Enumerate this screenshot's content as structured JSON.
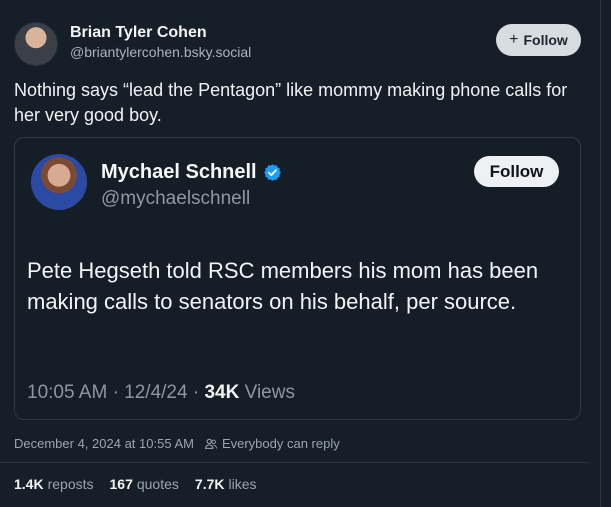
{
  "author": {
    "name": "Brian Tyler Cohen",
    "handle": "@briantylercohen.bsky.social",
    "follow_label": "Follow",
    "follow_icon": "+"
  },
  "post": {
    "text": "Nothing says “lead the Pentagon” like mommy making phone calls for her very good boy."
  },
  "embed": {
    "name": "Mychael Schnell",
    "handle": "@mychaelschnell",
    "verified": true,
    "follow_label": "Follow",
    "text": "Pete Hegseth told RSC members his mom has been making calls to senators on his behalf, per source.",
    "time": "10:05 AM",
    "sep1": "·",
    "date": "12/4/24",
    "sep2": "·",
    "views_count": "34K",
    "views_label": "Views"
  },
  "meta": {
    "timestamp": "December 4, 2024 at 10:55 AM",
    "reply_setting": "Everybody can reply"
  },
  "stats": {
    "reposts_count": "1.4K",
    "reposts_label": "reposts",
    "quotes_count": "167",
    "quotes_label": "quotes",
    "likes_count": "7.7K",
    "likes_label": "likes"
  },
  "colors": {
    "background": "#161e27",
    "verified": "#1d9bf0",
    "muted": "#9aa6b1"
  }
}
